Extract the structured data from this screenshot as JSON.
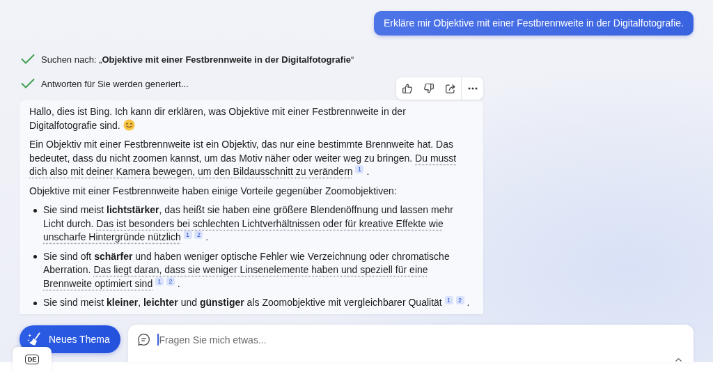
{
  "user_message": {
    "text": "Erkläre mir Objektive mit einer Festbrennweite in der Digitalfotografie."
  },
  "status_steps": [
    {
      "text": "Suchen nach: „**Objektive mit einer Festbrennweite in der Digitalfotografie**“",
      "done": true
    },
    {
      "text": "Antworten für Sie werden generiert...",
      "done": true
    }
  ],
  "response_actions": [
    {
      "kind": "thumbs_up"
    },
    {
      "kind": "thumbs_down"
    },
    {
      "kind": "share"
    },
    {
      "kind": "more"
    }
  ],
  "response": {
    "blocks": [
      {
        "kind": "paragraph",
        "parts": [
          {
            "kind": "text",
            "text": "Hallo, dies ist Bing. Ich kann dir erklären, was Objektive mit einer Festbrennweite in der Digitalfotografie sind."
          },
          {
            "kind": "emoji"
          }
        ]
      },
      {
        "kind": "paragraph",
        "parts": [
          {
            "kind": "text",
            "text": "Ein Objektiv mit einer Festbrennweite ist ein Objektiv, das nur eine bestimmte Brennweite hat. Das bedeutet, dass du nicht zoomen kannst, um das Motiv näher oder weiter weg zu bringen."
          },
          {
            "kind": "cited",
            "text": "Du musst dich also mit deiner Kamera bewegen, um den Bildausschnitt zu verändern"
          },
          {
            "kind": "citation",
            "text": "1"
          },
          {
            "kind": "text",
            "text": "."
          }
        ]
      },
      {
        "kind": "paragraph",
        "parts": [
          {
            "kind": "text",
            "text": "Objektive mit einer Festbrennweite haben einige Vorteile gegenüber Zoomobjektiven:"
          }
        ]
      },
      {
        "kind": "bullets",
        "items": [
          {
            "parts": [
              {
                "kind": "text",
                "text": "Sie sind meist **lichtstärker**, das heißt sie haben eine größere Blendenöffnung und lassen mehr Licht durch."
              },
              {
                "kind": "cited",
                "text": "Das ist besonders bei schlechten Lichtverhältnissen oder für kreative Effekte wie unscharfe Hintergründe nützlich"
              },
              {
                "kind": "citation",
                "text": "1"
              },
              {
                "kind": "citation",
                "text": "2"
              },
              {
                "kind": "text",
                "text": "."
              }
            ]
          },
          {
            "parts": [
              {
                "kind": "text",
                "text": "Sie sind oft **schärfer** und haben weniger optische Fehler wie Verzeichnung oder chromatische Aberration."
              },
              {
                "kind": "cited",
                "text": "Das liegt daran, dass sie weniger Linsenelemente haben und speziell für eine Brennweite optimiert sind"
              },
              {
                "kind": "citation",
                "text": "1"
              },
              {
                "kind": "citation",
                "text": "2"
              },
              {
                "kind": "text",
                "text": "."
              }
            ]
          },
          {
            "parts": [
              {
                "kind": "text",
                "text": "Sie sind meist **kleiner**, **leichter** und **günstiger** als Zoomobjektive mit vergleichbarer Qualität"
              },
              {
                "kind": "citation",
                "text": "1"
              },
              {
                "kind": "citation",
                "text": "2"
              },
              {
                "kind": "text",
                "text": "."
              }
            ]
          }
        ]
      }
    ]
  },
  "composer": {
    "new_topic_label": "Neues Thema",
    "placeholder": "Fragen Sie mich etwas...",
    "language": "DE"
  }
}
